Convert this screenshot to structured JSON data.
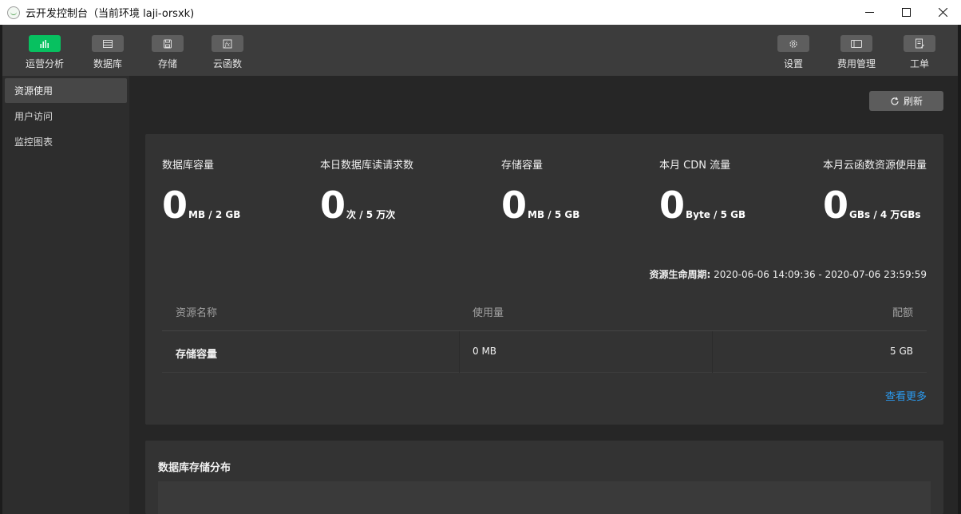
{
  "window": {
    "title": "云开发控制台（当前环境 laji-orsxk)"
  },
  "toolbar": {
    "left_items": [
      {
        "label": "运营分析",
        "icon": "bar-chart-icon",
        "active": true
      },
      {
        "label": "数据库",
        "icon": "database-icon",
        "active": false
      },
      {
        "label": "存储",
        "icon": "storage-icon",
        "active": false
      },
      {
        "label": "云函数",
        "icon": "cloud-function-icon",
        "active": false
      }
    ],
    "right_items": [
      {
        "label": "设置",
        "icon": "gear-icon"
      },
      {
        "label": "费用管理",
        "icon": "billing-icon"
      },
      {
        "label": "工单",
        "icon": "ticket-icon"
      }
    ],
    "accent_color": "#07c160"
  },
  "sidebar": {
    "items": [
      {
        "label": "资源使用",
        "active": true
      },
      {
        "label": "用户访问",
        "active": false
      },
      {
        "label": "监控图表",
        "active": false
      }
    ]
  },
  "main": {
    "refresh_label": "刷新",
    "stats": [
      {
        "label": "数据库容量",
        "value": "0",
        "unit": "MB / 2 GB"
      },
      {
        "label": "本日数据库读请求数",
        "value": "0",
        "unit": "次 / 5 万次"
      },
      {
        "label": "存储容量",
        "value": "0",
        "unit": "MB / 5 GB"
      },
      {
        "label": "本月 CDN 流量",
        "value": "0",
        "unit": "Byte / 5 GB"
      },
      {
        "label": "本月云函数资源使用量",
        "value": "0",
        "unit": "GBs / 4 万GBs"
      }
    ],
    "lifecycle": {
      "label": "资源生命周期:",
      "value": "2020-06-06 14:09:36 - 2020-07-06 23:59:59"
    },
    "table": {
      "headers": [
        "资源名称",
        "使用量",
        "配额"
      ],
      "rows": [
        [
          "存储容量",
          "0 MB",
          "5 GB"
        ]
      ]
    },
    "more_label": "查看更多",
    "link_color": "#2b9bf0",
    "section2_title": "数据库存储分布"
  }
}
